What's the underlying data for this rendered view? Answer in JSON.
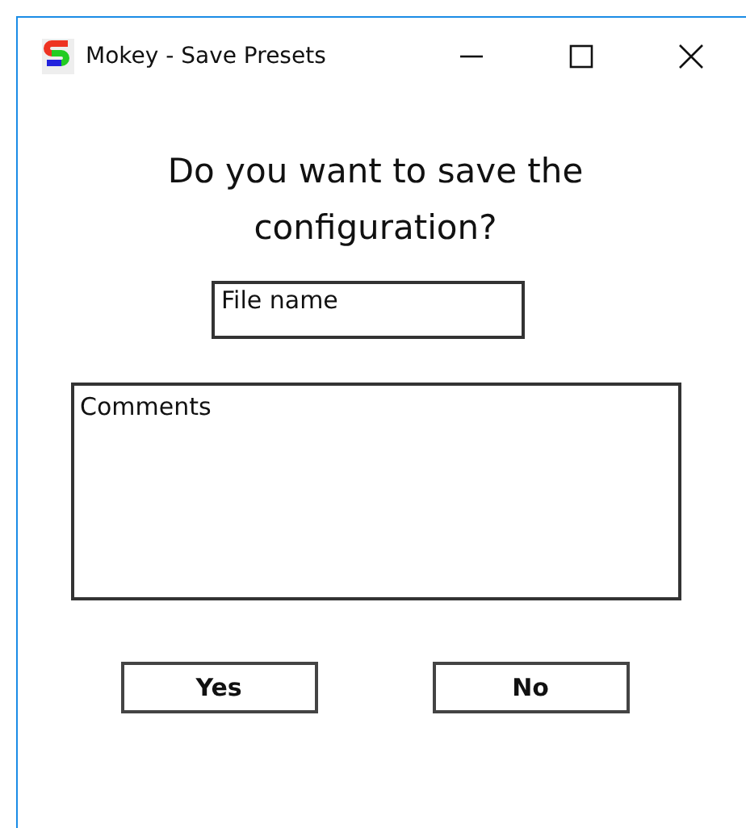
{
  "window": {
    "title": "Mokey - Save Presets"
  },
  "question": "Do you want to save the configuration?",
  "file_name": {
    "value": "File name"
  },
  "comments": {
    "value": "Comments"
  },
  "buttons": [
    "Yes",
    "No"
  ]
}
